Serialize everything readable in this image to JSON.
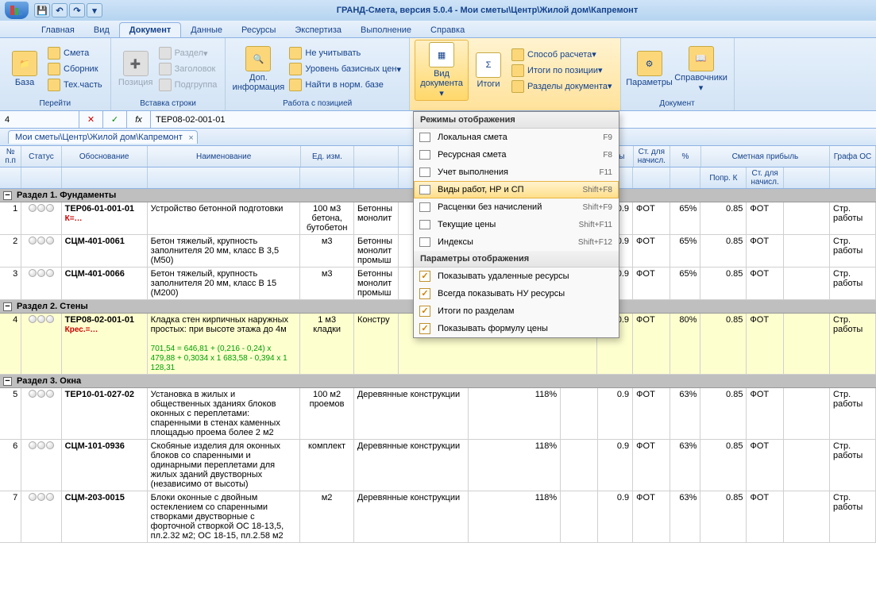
{
  "title": "ГРАНД-Смета, версия 5.0.4 - Мои сметы\\Центр\\Жилой дом\\Капремонт",
  "tabs": {
    "t0": "Главная",
    "t1": "Вид",
    "t2": "Документ",
    "t3": "Данные",
    "t4": "Ресурсы",
    "t5": "Экспертиза",
    "t6": "Выполнение",
    "t7": "Справка"
  },
  "ribbon": {
    "perehod": {
      "label": "Перейти",
      "baza": "База",
      "smeta": "Смета",
      "sbornik": "Сборник",
      "teh": "Тех.часть"
    },
    "vstavka": {
      "label": "Вставка строки",
      "poz": "Позиция",
      "razdel": "Раздел",
      "zagolovok": "Заголовок",
      "podgruppa": "Подгруппа"
    },
    "rabota": {
      "label": "Работа с позицией",
      "dopinfo": "Доп. информация",
      "neuch": "Не учитывать",
      "uroven": "Уровень базисных цен",
      "naiti": "Найти в норм. базе"
    },
    "predstav": {
      "vid": "Вид документа",
      "itogi": "Итоги",
      "sposob": "Способ расчета",
      "itpos": "Итоги по позиции",
      "razdely": "Разделы документа"
    },
    "dokument": {
      "label": "Документ",
      "param": "Параметры",
      "sprav": "Справочники"
    }
  },
  "formula": {
    "row": "4",
    "fx": "fx",
    "val": "ТЕР08-02-001-01"
  },
  "doctab": "Мои сметы\\Центр\\Жилой дом\\Капремонт",
  "headers": {
    "np": "№ п.п",
    "status": "Статус",
    "obos": "Обоснование",
    "naim": "Наименование",
    "ed": "Ед. изм.",
    "hody": "ходы",
    "stn": "Ст. для начисл.",
    "pct": "%",
    "pribyl": "Сметная прибыль",
    "popr": "Попр. К",
    "stn2": "Ст. для начисл.",
    "grafa": "Графа ОС"
  },
  "dropdown": {
    "hdr1": "Режимы отображения",
    "i1": "Локальная смета",
    "s1": "F9",
    "i2": "Ресурсная смета",
    "s2": "F8",
    "i3": "Учет выполнения",
    "s3": "F11",
    "i4": "Виды работ, НР и СП",
    "s4": "Shift+F8",
    "i5": "Расценки без начислений",
    "s5": "Shift+F9",
    "i6": "Текущие цены",
    "s6": "Shift+F11",
    "i7": "Индексы",
    "s7": "Shift+F12",
    "hdr2": "Параметры отображения",
    "c1": "Показывать удаленные ресурсы",
    "c2": "Всегда показывать НУ ресурсы",
    "c3": "Итоги по разделам",
    "c4": "Показывать формулу цены"
  },
  "sections": {
    "s1": "Раздел 1. Фундаменты",
    "s2": "Раздел 2. Стены",
    "s3": "Раздел 3. Окна"
  },
  "rows": {
    "r1": {
      "n": "1",
      "obos": "ТЕР06-01-001-01",
      "k": "К=…",
      "naim": "Устройство бетонной подготовки",
      "ed": "100 м3 бетона, бутобетон",
      "trunc": "Бетонны монолит",
      "hody": "0.9",
      "fot": "ФОТ",
      "pct": "65%",
      "popr": "0.85",
      "grafa": "Стр. работы"
    },
    "r2": {
      "n": "2",
      "obos": "СЦМ-401-0061",
      "naim": "Бетон тяжелый, крупность заполнителя 20 мм, класс В 3,5 (М50)",
      "ed": "м3",
      "trunc": "Бетонны монолит промыш",
      "hody": "0.9",
      "fot": "ФОТ",
      "pct": "65%",
      "popr": "0.85",
      "grafa": "Стр. работы"
    },
    "r3": {
      "n": "3",
      "obos": "СЦМ-401-0066",
      "naim": "Бетон тяжелый, крупность заполнителя 20 мм, класс В 15 (М200)",
      "ed": "м3",
      "trunc": "Бетонны монолит промыш",
      "hody": "0.9",
      "fot": "ФОТ",
      "pct": "65%",
      "popr": "0.85",
      "grafa": "Стр. работы"
    },
    "r4": {
      "n": "4",
      "obos": "ТЕР08-02-001-01",
      "k": "Крес.=…",
      "naim": "Кладка стен кирпичных наружных простых: при высоте этажа до 4м",
      "ed": "1 м3 кладки",
      "trunc": "Констру",
      "formula": "701,54 = 646,81 + (0,216 - 0,24) x 479,88 + 0,3034 x 1 683,58 - 0,394 x 1 128,31",
      "hody": "0.9",
      "fot": "ФОТ",
      "pct": "80%",
      "popr": "0.85",
      "grafa": "Стр. работы"
    },
    "r5": {
      "n": "5",
      "obos": "ТЕР10-01-027-02",
      "naim": "Установка в жилых и общественных зданиях блоков оконных с переплетами: спаренными в стенах каменных площадью проема более 2 м2",
      "ed": "100 м2 проемов",
      "trunc": "Деревянные конструкции",
      "hody": "118%",
      "hody2": "0.9",
      "fot": "ФОТ",
      "pct": "63%",
      "popr": "0.85",
      "grafa": "Стр. работы"
    },
    "r6": {
      "n": "6",
      "obos": "СЦМ-101-0936",
      "naim": "Скобяные изделия для оконных блоков со спаренными и одинарными переплетами для жилых зданий двустворных (независимо от высоты)",
      "ed": "комплект",
      "trunc": "Деревянные конструкции",
      "hody": "118%",
      "hody2": "0.9",
      "fot": "ФОТ",
      "pct": "63%",
      "popr": "0.85",
      "grafa": "Стр. работы"
    },
    "r7": {
      "n": "7",
      "obos": "СЦМ-203-0015",
      "naim": "Блоки оконные с двойным остеклением со спаренными створками двустворные с форточной створкой ОС 18-13,5, пл.2.32 м2; ОС 18-15, пл.2.58 м2",
      "ed": "м2",
      "trunc": "Деревянные конструкции",
      "hody": "118%",
      "hody2": "0.9",
      "fot": "ФОТ",
      "pct": "63%",
      "popr": "0.85",
      "grafa": "Стр. работы"
    }
  }
}
